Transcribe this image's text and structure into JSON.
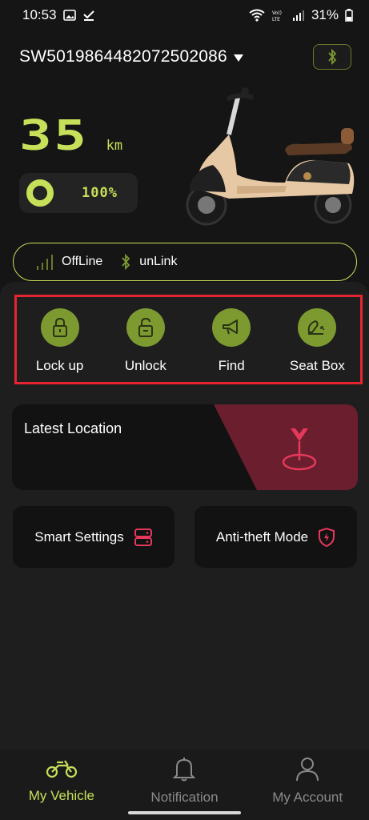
{
  "status_bar": {
    "time": "10:53",
    "battery": "31%"
  },
  "device": {
    "id": "SW5019864482072502086"
  },
  "range": {
    "value": "35",
    "unit": "km"
  },
  "battery": {
    "percent_label": "100%",
    "level": 1.0
  },
  "connection": {
    "network_label": "OffLine",
    "bluetooth_label": "unLink"
  },
  "actions": [
    {
      "label": "Lock up",
      "icon": "lock-closed-icon"
    },
    {
      "label": "Unlock",
      "icon": "lock-open-icon"
    },
    {
      "label": "Find",
      "icon": "horn-icon"
    },
    {
      "label": "Seat Box",
      "icon": "seat-box-icon"
    }
  ],
  "location": {
    "title": "Latest Location",
    "icon": "location-pin-icon"
  },
  "cards": {
    "smart_settings": {
      "label": "Smart Settings",
      "icon": "server-icon"
    },
    "anti_theft": {
      "label": "Anti-theft Mode",
      "icon": "shield-bolt-icon"
    }
  },
  "tabs": [
    {
      "label": "My Vehicle",
      "icon": "motorcycle-icon",
      "active": true
    },
    {
      "label": "Notification",
      "icon": "bell-icon",
      "active": false
    },
    {
      "label": "My Account",
      "icon": "user-icon",
      "active": false
    }
  ],
  "colors": {
    "accent": "#c6e05a",
    "action_circle": "#7d9a31",
    "highlight_border": "#e5252f",
    "danger": "#e5385a",
    "background": "#151515"
  }
}
